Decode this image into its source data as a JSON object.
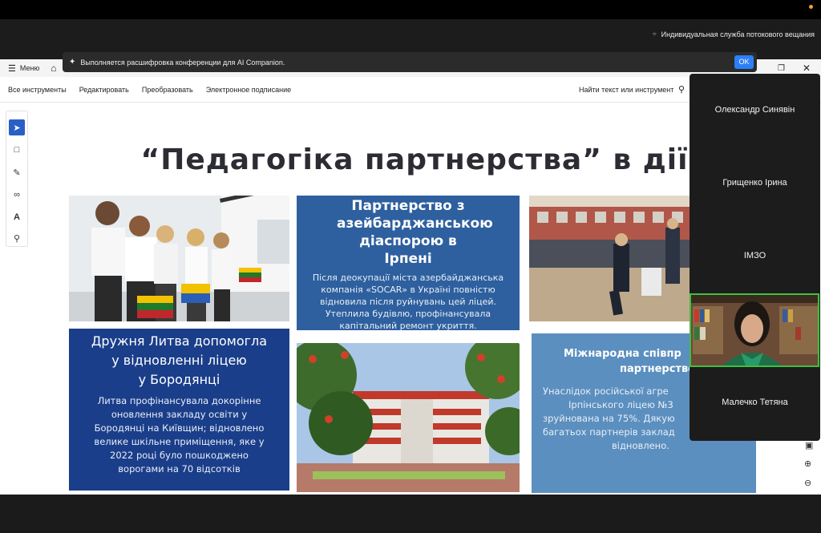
{
  "zoom": {
    "streaming_label": "Индивидуальная служба потокового вещания",
    "notification": "Выполняется расшифровка конференции для AI Companion.",
    "ok_label": "OK"
  },
  "app": {
    "menu_label": "Меню",
    "tools": [
      "Все инструменты",
      "Редактировать",
      "Преобразовать",
      "Электронное подписание"
    ],
    "search_label": "Найти текст или инструмент"
  },
  "slide": {
    "title": "“Педагогіка партнерства” в дії",
    "panel1": {
      "heading": "Партнерство з азейбарджанською діаспорою в Ірпені",
      "body_lines": [
        "Після деокупації міста  азербайджанська",
        "компанія «SOCAR» в Україні повністю",
        "відновила після руйнувань цей ліцей.",
        "Утеплила будівлю, профінансувала",
        "капітальний ремонт укриття."
      ]
    },
    "panel2": {
      "heading_lines": [
        "Дружня Литва допомогла",
        "у відновленні ліцею",
        "у Бородянці"
      ],
      "body_lines": [
        "Литва профінансувала докорінне",
        "оновлення закладу освіти у",
        "Бородянці на Київщин;  відновлено",
        "велике шкільне приміщення, яке у",
        "2022 році було пошкоджено",
        "ворогами на 70 відсотків"
      ]
    },
    "panel3": {
      "heading_lines": [
        "Міжнародна співпр",
        "партнерство"
      ],
      "body_lines": [
        "Унаслідок російської агре",
        "Ірпінського ліцею №3",
        "зруйнована на 75%. Дякую",
        "багатьох партнерів заклад",
        "відновлено."
      ]
    }
  },
  "participants": [
    "Олександр Синявін",
    "Грищенко Ірина",
    "ІМЗО",
    "Малечко Тетяна"
  ],
  "colors": {
    "panel_blue": "#2e5f9e",
    "panel_navy": "#1b3e8a",
    "panel_light": "#5b8fbf",
    "speaker_border": "#3fbf3f",
    "ok_button": "#2d7ff9"
  }
}
